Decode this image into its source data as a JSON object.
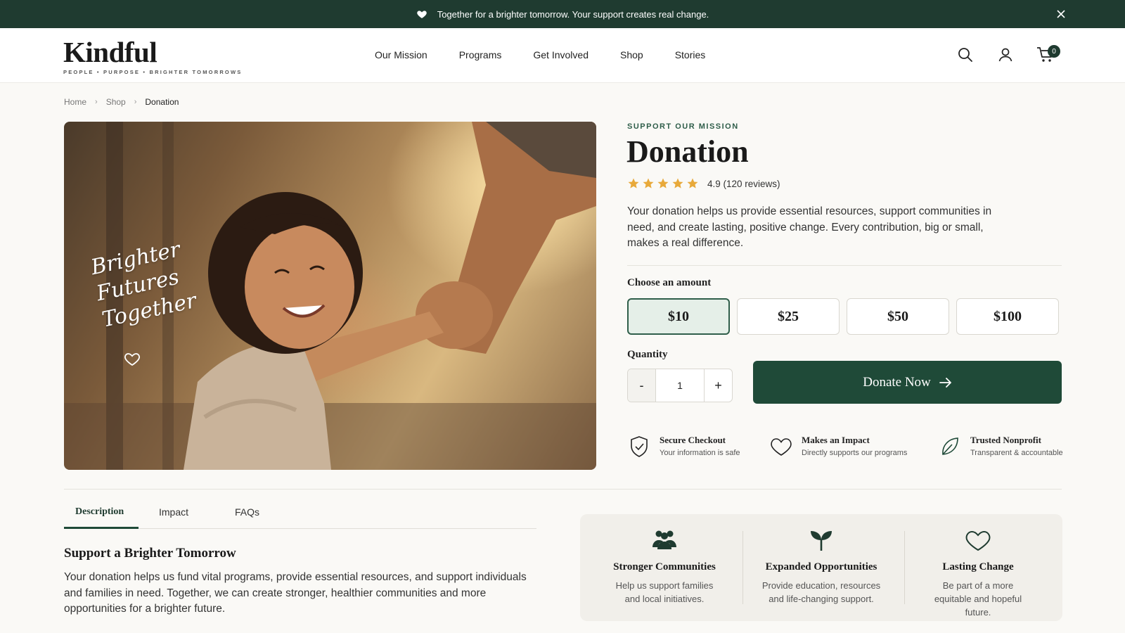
{
  "announcement": {
    "text": "Together for a brighter tomorrow. Your support creates real change."
  },
  "brand": {
    "name": "Kindful",
    "tagline": "PEOPLE  •  PURPOSE  •  BRIGHTER TOMORROWS",
    "accent_color": "#1f3b30"
  },
  "nav": {
    "items": [
      "Our Mission",
      "Programs",
      "Get Involved",
      "Shop",
      "Stories"
    ]
  },
  "header": {
    "cart_count": "0",
    "icons": [
      "search-icon",
      "user-icon",
      "cart-icon"
    ]
  },
  "breadcrumb": {
    "items": [
      "Home",
      "Shop",
      "Donation"
    ]
  },
  "hero": {
    "script_lines": [
      "Brighter",
      "Futures",
      "Together"
    ]
  },
  "product": {
    "eyebrow": "SUPPORT OUR MISSION",
    "title": "Donation",
    "rating": 4.9,
    "rating_text": "4.9 (120 reviews)",
    "description": "Your donation helps us provide essential resources, support communities in need, and create lasting, positive change. Every contribution, big or small, makes a real difference."
  },
  "amounts": {
    "label": "Choose an amount",
    "options": [
      "$10",
      "$25",
      "$50",
      "$100"
    ],
    "selected": "$10"
  },
  "quantity": {
    "label": "Quantity",
    "value": "1",
    "minus": "-",
    "plus": "+"
  },
  "cta": {
    "label": "Donate Now"
  },
  "trust": [
    {
      "title": "Secure Checkout",
      "subtitle": "Your information is safe",
      "icon": "shield-check-icon"
    },
    {
      "title": "Makes an Impact",
      "subtitle": "Directly supports our programs",
      "icon": "heart-icon"
    },
    {
      "title": "Trusted Nonprofit",
      "subtitle": "Transparent & accountable",
      "icon": "leaf-icon"
    }
  ],
  "tabs": {
    "items": [
      "Description",
      "Impact",
      "FAQs"
    ],
    "active": "Description"
  },
  "description_section": {
    "title": "Support a Brighter Tomorrow",
    "body": "Your donation helps us fund vital programs, provide essential resources, and support individuals and families in need. Together, we can create stronger, healthier communities and more opportunities for a brighter future."
  },
  "impact_cards": [
    {
      "title": "Stronger Communities",
      "text": "Help us support families and local initiatives.",
      "icon": "community-icon"
    },
    {
      "title": "Expanded Opportunities",
      "text": "Provide education, resources and life-changing support.",
      "icon": "sprout-icon"
    },
    {
      "title": "Lasting Change",
      "text": "Be part of a more equitable and hopeful future.",
      "icon": "heart-outline-icon"
    }
  ]
}
